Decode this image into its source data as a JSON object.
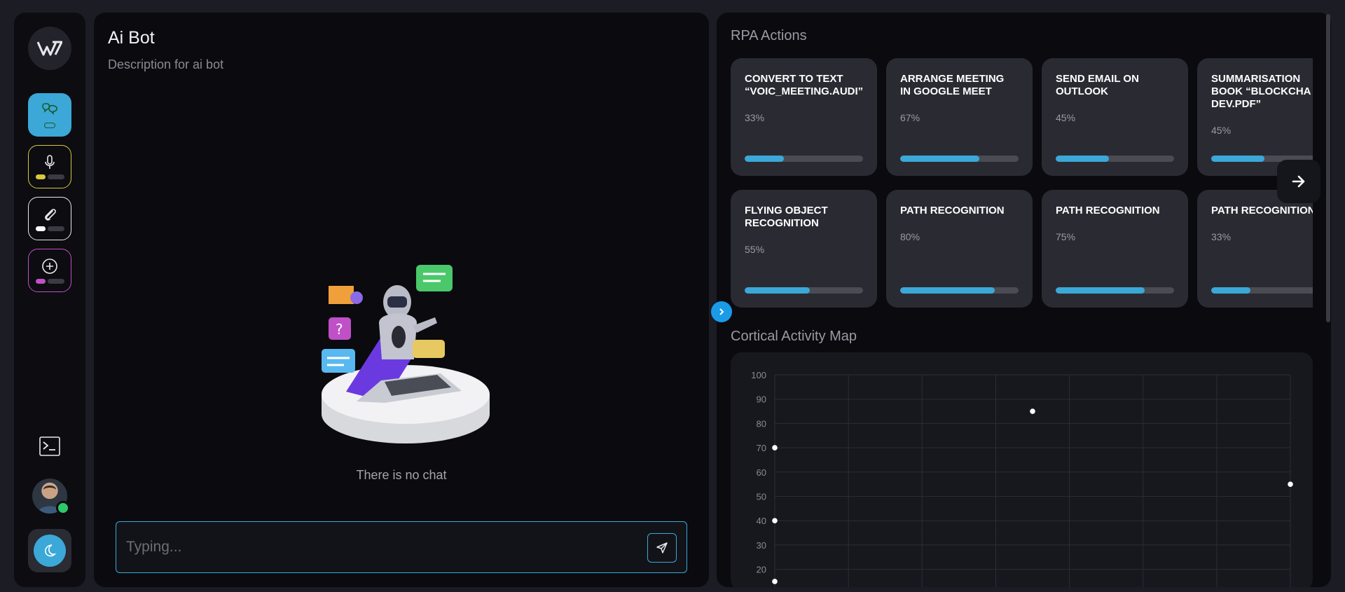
{
  "sidebar": {
    "logo_icon": "brand-logo-icon",
    "tools": [
      {
        "name": "chatbot",
        "icon": "chatbot-icon",
        "accent": "#3ba8d8",
        "active": true
      },
      {
        "name": "voice",
        "icon": "microphone-icon",
        "accent": "#d8c83a"
      },
      {
        "name": "attachment",
        "icon": "paperclip-icon",
        "accent": "#ffffff"
      },
      {
        "name": "add",
        "icon": "plus-circle-icon",
        "accent": "#c050c8"
      }
    ],
    "terminal_icon": "terminal-icon",
    "status": "online",
    "theme_icon": "moon-icon"
  },
  "chat": {
    "title": "Ai Bot",
    "description": "Description for ai bot",
    "empty_text": "There is no chat",
    "input_placeholder": "Typing...",
    "send_icon": "send-icon"
  },
  "rpa": {
    "title": "RPA Actions",
    "cards": [
      {
        "title": "CONVERT TO TEXT\n“VOIC_MEETING.AUDI”",
        "percent_label": "33%",
        "progress": 0.33
      },
      {
        "title": "ARRANGE MEETING\nIN GOOGLE MEET",
        "percent_label": "67%",
        "progress": 0.67
      },
      {
        "title": "SEND EMAIL ON\nOUTLOOK",
        "percent_label": "45%",
        "progress": 0.45
      },
      {
        "title": "SUMMARISATION\nBOOK “BLOCKCHA\nDEV.PDF”",
        "percent_label": "45%",
        "progress": 0.45
      },
      {
        "title": "FLYING OBJECT\nRECOGNITION",
        "percent_label": "55%",
        "progress": 0.55
      },
      {
        "title": "PATH RECOGNITION",
        "percent_label": "80%",
        "progress": 0.8
      },
      {
        "title": "PATH RECOGNITION",
        "percent_label": "75%",
        "progress": 0.75
      },
      {
        "title": "PATH RECOGNITION",
        "percent_label": "33%",
        "progress": 0.33
      }
    ],
    "next_icon": "arrow-right-icon"
  },
  "map": {
    "title": "Cortical Activity Map"
  },
  "chart_data": {
    "type": "scatter",
    "title": "",
    "xlabel": "",
    "ylabel": "",
    "ylim": [
      10,
      100
    ],
    "xlim": [
      0,
      7
    ],
    "yticks": [
      "100",
      "90",
      "80",
      "70",
      "60",
      "50",
      "40",
      "30",
      "20"
    ],
    "grid": true,
    "points": [
      {
        "x": 0,
        "y": 70
      },
      {
        "x": 0,
        "y": 40
      },
      {
        "x": 0,
        "y": 15
      },
      {
        "x": 3.5,
        "y": 85
      },
      {
        "x": 7,
        "y": 55
      }
    ]
  }
}
